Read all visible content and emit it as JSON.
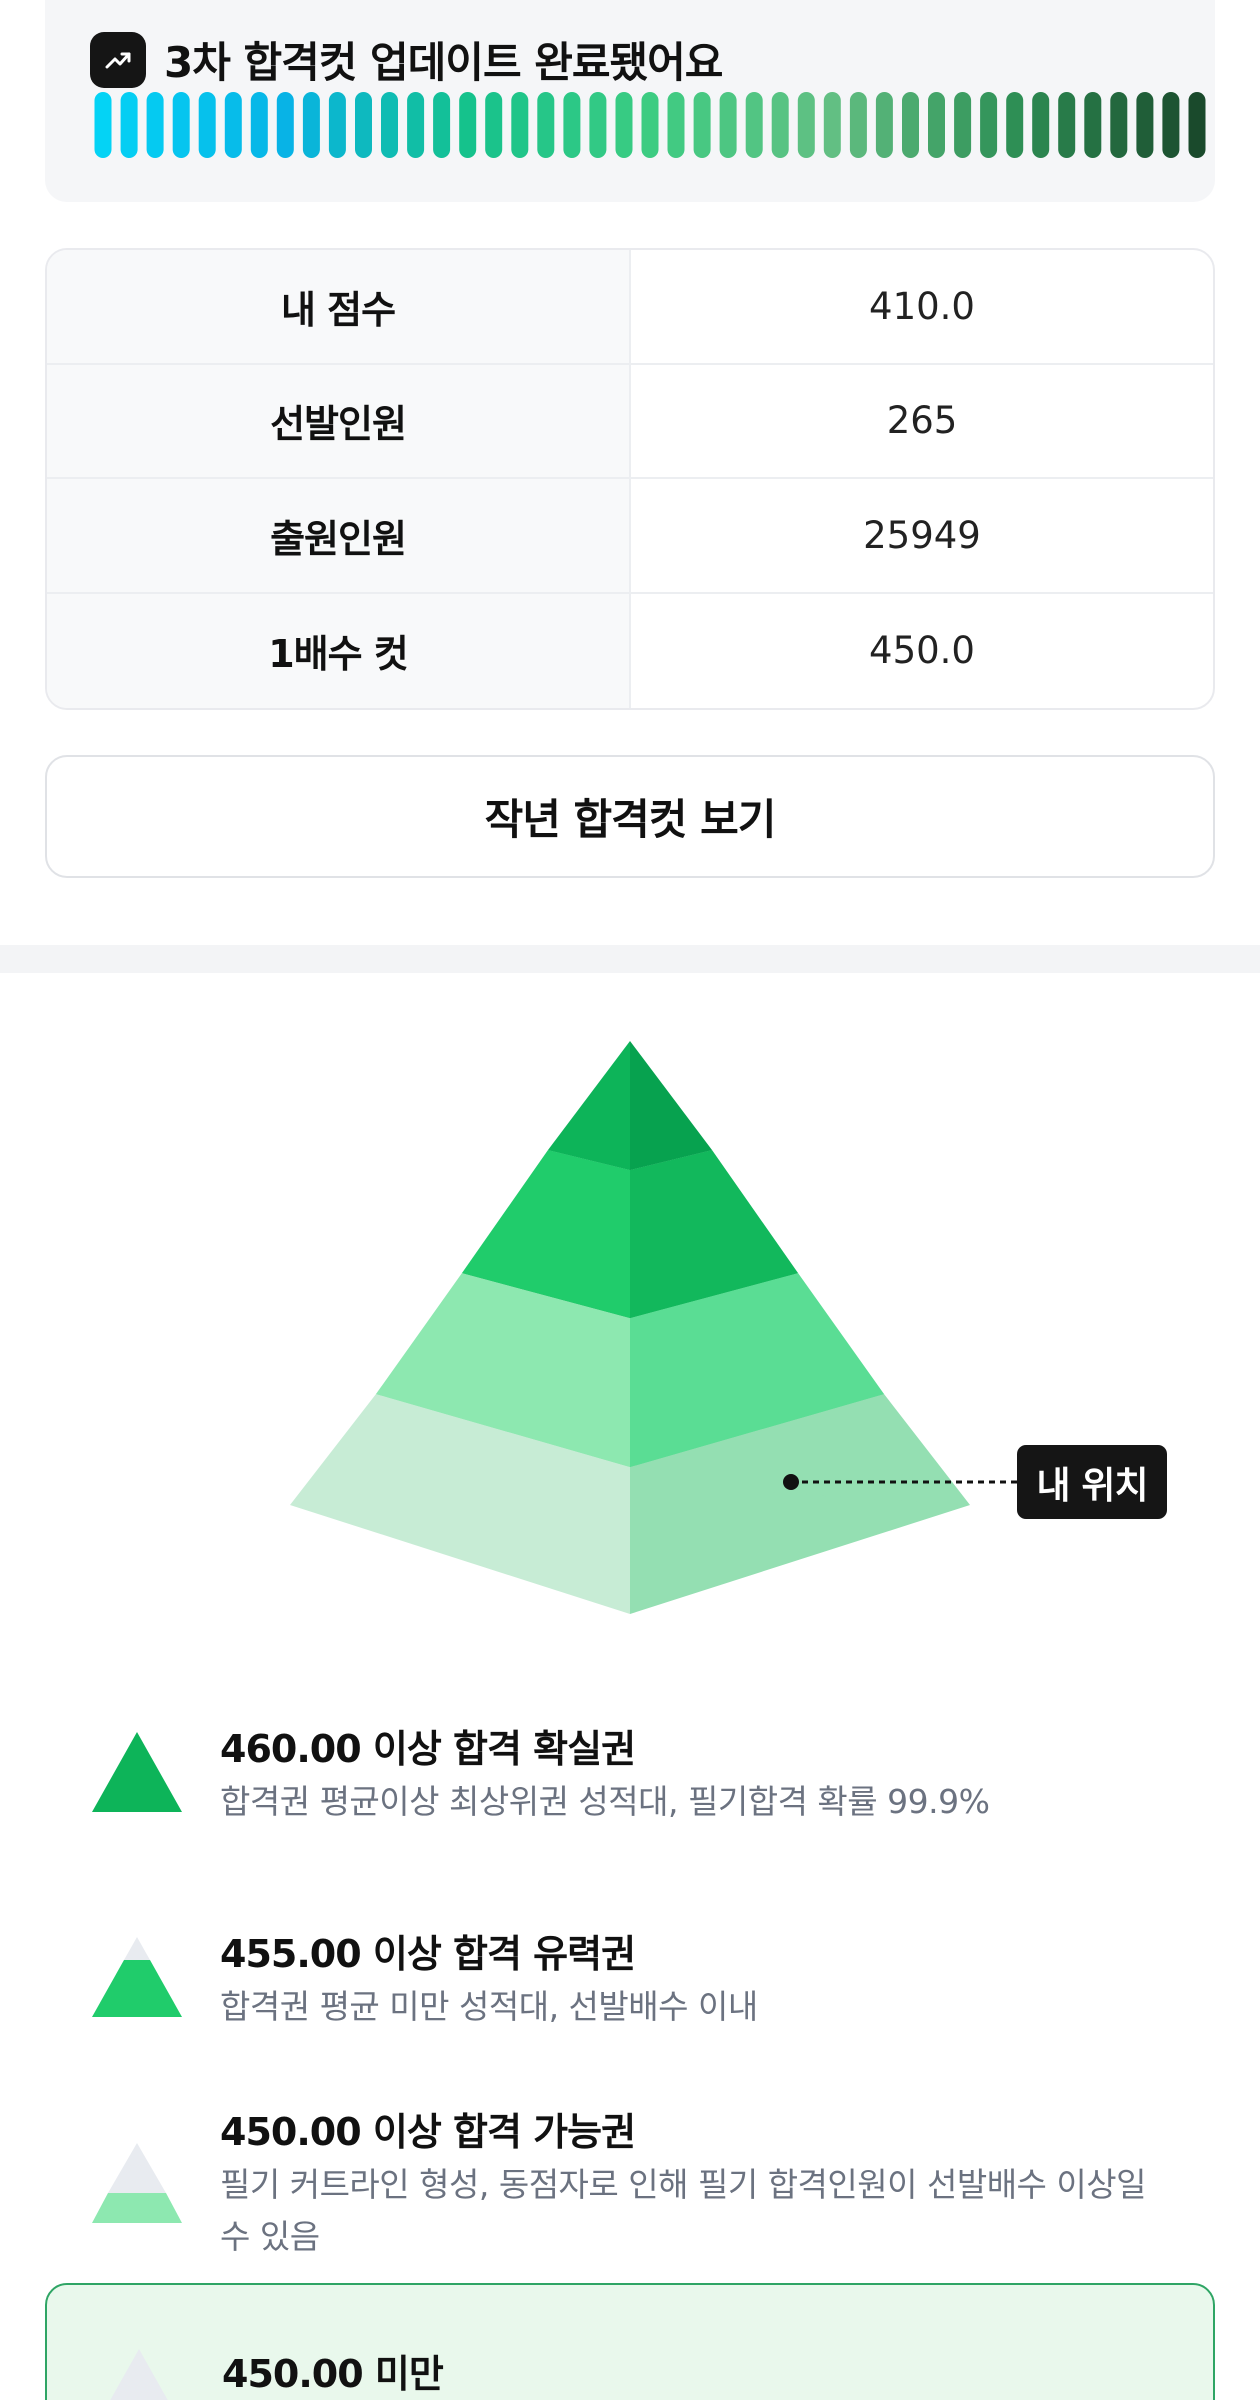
{
  "status": {
    "title": "3차 합격컷 업데이트 완료됐어요",
    "icon": "trending-up-icon",
    "progress_bar": {
      "segments": 43,
      "gradient_colors": [
        "#04d3f5",
        "#08b3e6",
        "#15c28c",
        "#3dcc82",
        "#62bf83",
        "#2e8f55",
        "#1a4a2c"
      ]
    }
  },
  "info_table": {
    "rows": [
      {
        "label": "내 점수",
        "value": "410.0"
      },
      {
        "label": "선발인원",
        "value": "265"
      },
      {
        "label": "출원인원",
        "value": "25949"
      },
      {
        "label": "1배수 컷",
        "value": "450.0"
      }
    ]
  },
  "last_year_button": {
    "label": "작년 합격컷 보기"
  },
  "pyramid": {
    "my_position_label": "내 위치",
    "tier_colors": [
      "#0db459",
      "#20cc6b",
      "#8de8b0",
      "#c7ecd5"
    ]
  },
  "legend": [
    {
      "title": "460.00 이상 합격 확실권",
      "desc": "합격권 평균이상 최상위권 성적대, 필기합격 확률 99.9%",
      "icon": "pyramid-tier-1-icon"
    },
    {
      "title": "455.00 이상 합격 유력권",
      "desc": "합격권 평균 미만 성적대, 선발배수 이내",
      "icon": "pyramid-tier-2-icon"
    },
    {
      "title": "450.00 이상 합격 가능권",
      "desc": "필기 커트라인 형성, 동점자로 인해 필기 합격인원이 선발배수 이상일 수 있음",
      "icon": "pyramid-tier-3-icon"
    },
    {
      "title": "450.00 미만",
      "desc": "",
      "icon": "pyramid-tier-4-icon"
    }
  ]
}
